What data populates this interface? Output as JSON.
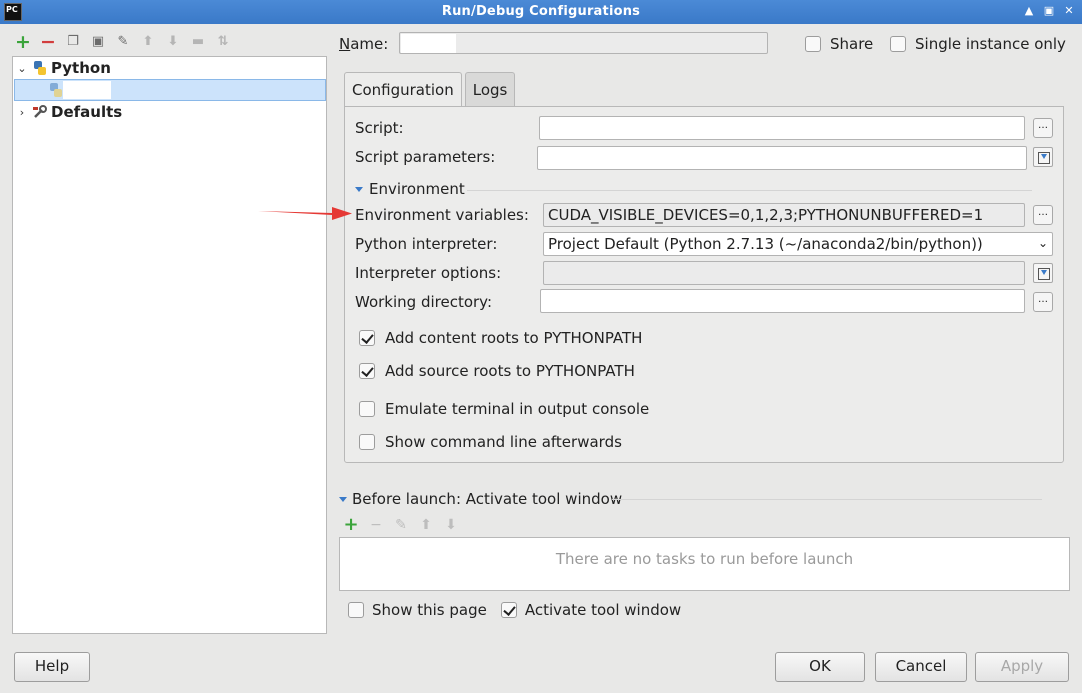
{
  "window": {
    "title": "Run/Debug Configurations",
    "app_icon": "PC",
    "controls": [
      "minimize-icon",
      "maximize-icon",
      "close-icon"
    ]
  },
  "toolbar": {
    "icons": [
      "add-icon",
      "remove-icon",
      "copy-icon",
      "save-icon",
      "wrench-icon",
      "move-up-icon",
      "move-down-icon",
      "folder-icon",
      "sort-icon"
    ]
  },
  "tree": {
    "nodes": [
      {
        "label": "Python",
        "expanded": true
      },
      {
        "label": "Defaults",
        "expanded": false
      }
    ]
  },
  "name": {
    "label": "Name:",
    "value": ""
  },
  "share": {
    "label": "Share",
    "checked": false
  },
  "single_instance": {
    "label": "Single instance only",
    "checked": false
  },
  "tabs": [
    {
      "label": "Configuration",
      "active": true
    },
    {
      "label": "Logs",
      "active": false
    }
  ],
  "config": {
    "script_label": "Script:",
    "script_value": "",
    "script_params_label": "Script parameters:",
    "script_params_value": "",
    "environment_section": "Environment",
    "env_vars_label": "Environment variables:",
    "env_vars_value": "CUDA_VISIBLE_DEVICES=0,1,2,3;PYTHONUNBUFFERED=1",
    "interpreter_label": "Python interpreter:",
    "interpreter_value": "Project Default (Python 2.7.13 (~/anaconda2/bin/python))",
    "interp_options_label": "Interpreter options:",
    "interp_options_value": "",
    "workdir_label": "Working directory:",
    "workdir_value": "",
    "checkboxes": [
      {
        "label": "Add content roots to PYTHONPATH",
        "checked": true
      },
      {
        "label": "Add source roots to PYTHONPATH",
        "checked": true
      },
      {
        "label": "Emulate terminal in output console",
        "checked": false
      },
      {
        "label": "Show command line afterwards",
        "checked": false
      }
    ]
  },
  "before_launch": {
    "title": "Before launch: Activate tool window",
    "empty_text": "There are no tasks to run before launch",
    "show_page_label": "Show this page",
    "show_page_checked": false,
    "activate_label": "Activate tool window",
    "activate_checked": true
  },
  "buttons": {
    "help": "Help",
    "ok": "OK",
    "cancel": "Cancel",
    "apply": "Apply"
  },
  "colors": {
    "title_bar": "#3a79c8",
    "annotation_arrow": "#e53935"
  }
}
